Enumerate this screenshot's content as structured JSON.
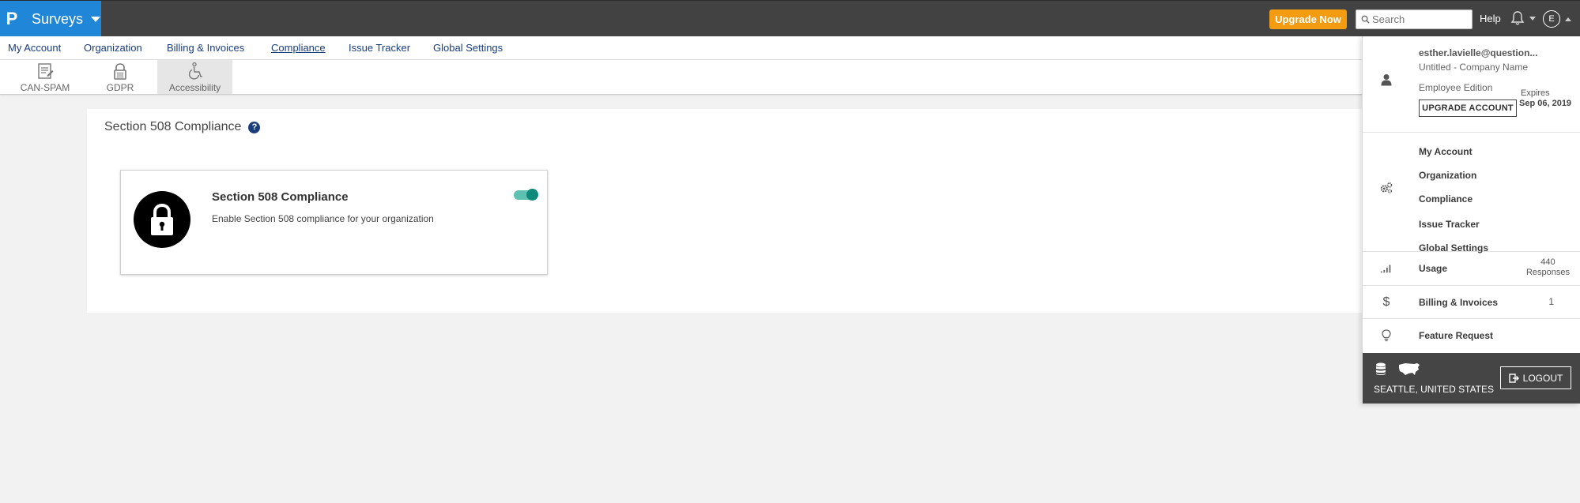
{
  "brand": {
    "logo_letter": "P",
    "app_name": "Surveys"
  },
  "topbar": {
    "upgrade_now": "Upgrade Now",
    "search_placeholder": "Search",
    "help": "Help",
    "avatar_letter": "E"
  },
  "subnav": {
    "items": [
      "My Account",
      "Organization",
      "Billing & Invoices",
      "Compliance",
      "Issue Tracker",
      "Global Settings"
    ],
    "active": "Compliance"
  },
  "icon_tabs": [
    {
      "label": "CAN-SPAM",
      "icon": "document-icon"
    },
    {
      "label": "GDPR",
      "icon": "lock-icon"
    },
    {
      "label": "Accessibility",
      "icon": "wheelchair-icon",
      "active": true
    }
  ],
  "panel": {
    "title": "Section 508 Compliance",
    "help_icon": "?",
    "card": {
      "title": "Section 508 Compliance",
      "description": "Enable Section 508 compliance for your organization",
      "enabled": true
    }
  },
  "account_menu": {
    "email": "esther.lavielle@question...",
    "company": "Untitled - Company Name",
    "edition": "Employee Edition",
    "upgrade_account": "UPGRADE ACCOUNT",
    "expires_label": "Expires",
    "expires_date": "Sep 06, 2019",
    "settings_links": [
      "My Account",
      "Organization",
      "Compliance",
      "Issue Tracker",
      "Global Settings"
    ],
    "usage_label": "Usage",
    "usage_count": "440",
    "usage_unit": "Responses",
    "billing_label": "Billing & Invoices",
    "billing_count": "1",
    "feature_request": "Feature Request",
    "location": "SEATTLE, UNITED STATES",
    "logout": "LOGOUT"
  },
  "colors": {
    "topbar_bg": "#424242",
    "brand_blue": "#1f86d8",
    "upgrade_orange": "#f39c12",
    "nav_link": "#1a3d7c",
    "toggle_on": "#0e8a7a"
  }
}
